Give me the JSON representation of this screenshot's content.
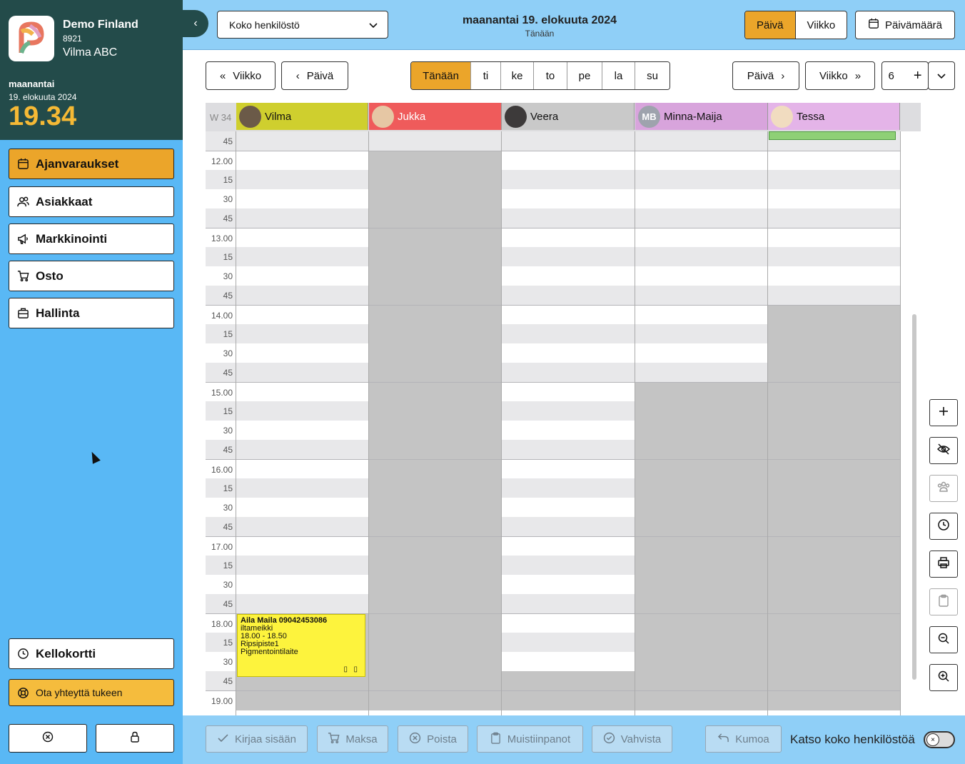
{
  "sidebar": {
    "company": "Demo Finland",
    "code": "8921",
    "user": "Vilma ABC",
    "weekday": "maanantai",
    "date": "19. elokuuta 2024",
    "time": "19.34",
    "nav": [
      {
        "label": "Ajanvaraukset",
        "icon": "calendar-icon"
      },
      {
        "label": "Asiakkaat",
        "icon": "users-icon"
      },
      {
        "label": "Markkinointi",
        "icon": "megaphone-icon"
      },
      {
        "label": "Osto",
        "icon": "cart-icon"
      },
      {
        "label": "Hallinta",
        "icon": "briefcase-icon"
      }
    ],
    "timecard": "Kellokortti",
    "support": "Ota yhteyttä tukeen"
  },
  "topbar": {
    "staff_filter": "Koko henkilöstö",
    "title_date": "maanantai 19. elokuuta 2024",
    "title_sub": "Tänään",
    "view_day": "Päivä",
    "view_week": "Viikko",
    "date_picker": "Päivämäärä"
  },
  "nav": {
    "prev_week": "Viikko",
    "prev_day": "Päivä",
    "days": [
      "Tänään",
      "ti",
      "ke",
      "to",
      "pe",
      "la",
      "su"
    ],
    "next_day": "Päivä",
    "next_week": "Viikko",
    "column_count": "6"
  },
  "calendar": {
    "week": "W 34",
    "staff": [
      {
        "name": "Vilma",
        "color": "#cfcf2e"
      },
      {
        "name": "Jukka",
        "color": "#ef5b5b"
      },
      {
        "name": "Veera",
        "color": "#c9c9c9"
      },
      {
        "name": "Minna-Maija",
        "color": "#d8a4dc",
        "initials": "MB"
      },
      {
        "name": "Tessa",
        "color": "#e4b4e8"
      }
    ],
    "time_labels": [
      "45",
      "12.00",
      "15",
      "30",
      "45",
      "13.00",
      "15",
      "30",
      "45",
      "14.00",
      "15",
      "30",
      "45",
      "15.00",
      "15",
      "30",
      "45",
      "16.00",
      "15",
      "30",
      "45",
      "17.00",
      "15",
      "30",
      "45",
      "18.00",
      "15",
      "30",
      "45",
      "19.00"
    ],
    "appointment": {
      "client": "Aila Maila 09042453086",
      "service": "iltameikki",
      "time": "18.00 - 18.50",
      "room": "Ripsipiste1",
      "device": "Pigmentointilaite"
    }
  },
  "bottom": {
    "checkin": "Kirjaa sisään",
    "pay": "Maksa",
    "delete": "Poista",
    "notes": "Muistiinpanot",
    "confirm": "Vahvista",
    "undo": "Kumoa",
    "see_all_staff": "Katso koko henkilöstöä"
  }
}
